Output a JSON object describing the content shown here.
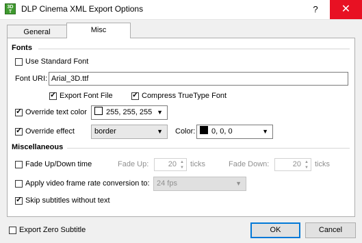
{
  "window": {
    "title": "DLP Cinema XML Export Options",
    "help": "?",
    "close": "✕",
    "icon_text": "3D T"
  },
  "tabs": [
    {
      "label": "General"
    },
    {
      "label": "Misc"
    }
  ],
  "fonts": {
    "header": "Fonts",
    "use_standard_font": "Use Standard Font",
    "font_uri_label": "Font URI:",
    "font_uri_value": "Arial_3D.ttf",
    "export_font_file": "Export Font File",
    "compress_truetype": "Compress TrueType Font",
    "override_text_color": "Override text color",
    "text_color_value": "255, 255, 255",
    "override_effect": "Override effect",
    "effect_value": "border",
    "color_label": "Color:",
    "effect_color_value": "0, 0, 0"
  },
  "misc": {
    "header": "Miscellaneous",
    "fade_time": "Fade Up/Down time",
    "fade_up_label": "Fade Up:",
    "fade_up_value": "20",
    "fade_up_unit": "ticks",
    "fade_down_label": "Fade Down:",
    "fade_down_value": "20",
    "fade_down_unit": "ticks",
    "apply_conversion": "Apply video frame rate conversion to:",
    "frame_rate_value": "24 fps",
    "skip_subtitles": "Skip subtitles without text"
  },
  "footer": {
    "export_zero_subtitle": "Export Zero Subtitle",
    "ok": "OK",
    "cancel": "Cancel"
  },
  "colors": {
    "text_color_swatch": "#ffffff",
    "effect_color_swatch": "#000000",
    "close_bg": "#e81123",
    "default_border": "#0078d7"
  }
}
